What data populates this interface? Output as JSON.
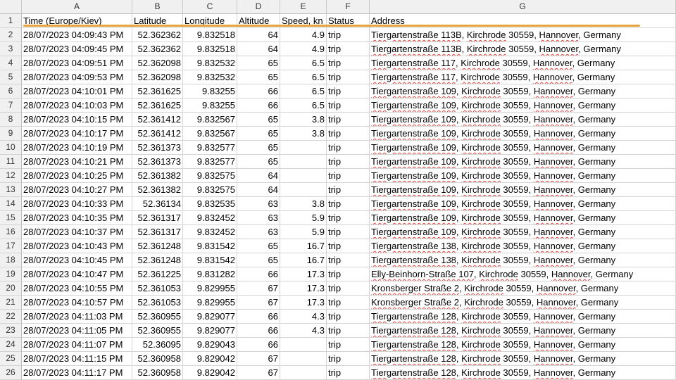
{
  "columns": [
    "A",
    "B",
    "C",
    "D",
    "E",
    "F",
    "G"
  ],
  "headers": [
    "Time (Europe/Kiev)",
    "Latitude",
    "Longitude",
    "Altitude",
    "Speed, kn",
    "Status",
    "Address"
  ],
  "accent_color": "#e8a33d",
  "rows": [
    {
      "n": "2",
      "time": "28/07/2023 04:09:43 PM",
      "lat": "52.362362",
      "lon": "9.832518",
      "alt": "64",
      "spd": "4.9",
      "status": "trip",
      "street": "Tiergartenstraße 113B",
      "district": "Kirchrode",
      "zip": "30559",
      "city": "Hannover",
      "country": "Germany"
    },
    {
      "n": "3",
      "time": "28/07/2023 04:09:45 PM",
      "lat": "52.362362",
      "lon": "9.832518",
      "alt": "64",
      "spd": "4.9",
      "status": "trip",
      "street": "Tiergartenstraße 113B",
      "district": "Kirchrode",
      "zip": "30559",
      "city": "Hannover",
      "country": "Germany"
    },
    {
      "n": "4",
      "time": "28/07/2023 04:09:51 PM",
      "lat": "52.362098",
      "lon": "9.832532",
      "alt": "65",
      "spd": "6.5",
      "status": "trip",
      "street": "Tiergartenstraße 117",
      "district": "Kirchrode",
      "zip": "30559",
      "city": "Hannover",
      "country": "Germany"
    },
    {
      "n": "5",
      "time": "28/07/2023 04:09:53 PM",
      "lat": "52.362098",
      "lon": "9.832532",
      "alt": "65",
      "spd": "6.5",
      "status": "trip",
      "street": "Tiergartenstraße 117",
      "district": "Kirchrode",
      "zip": "30559",
      "city": "Hannover",
      "country": "Germany"
    },
    {
      "n": "6",
      "time": "28/07/2023 04:10:01 PM",
      "lat": "52.361625",
      "lon": "9.83255",
      "alt": "66",
      "spd": "6.5",
      "status": "trip",
      "street": "Tiergartenstraße 109",
      "district": "Kirchrode",
      "zip": "30559",
      "city": "Hannover",
      "country": "Germany"
    },
    {
      "n": "7",
      "time": "28/07/2023 04:10:03 PM",
      "lat": "52.361625",
      "lon": "9.83255",
      "alt": "66",
      "spd": "6.5",
      "status": "trip",
      "street": "Tiergartenstraße 109",
      "district": "Kirchrode",
      "zip": "30559",
      "city": "Hannover",
      "country": "Germany"
    },
    {
      "n": "8",
      "time": "28/07/2023 04:10:15 PM",
      "lat": "52.361412",
      "lon": "9.832567",
      "alt": "65",
      "spd": "3.8",
      "status": "trip",
      "street": "Tiergartenstraße 109",
      "district": "Kirchrode",
      "zip": "30559",
      "city": "Hannover",
      "country": "Germany"
    },
    {
      "n": "9",
      "time": "28/07/2023 04:10:17 PM",
      "lat": "52.361412",
      "lon": "9.832567",
      "alt": "65",
      "spd": "3.8",
      "status": "trip",
      "street": "Tiergartenstraße 109",
      "district": "Kirchrode",
      "zip": "30559",
      "city": "Hannover",
      "country": "Germany"
    },
    {
      "n": "10",
      "time": "28/07/2023 04:10:19 PM",
      "lat": "52.361373",
      "lon": "9.832577",
      "alt": "65",
      "spd": "",
      "status": "trip",
      "street": "Tiergartenstraße 109",
      "district": "Kirchrode",
      "zip": "30559",
      "city": "Hannover",
      "country": "Germany"
    },
    {
      "n": "11",
      "time": "28/07/2023 04:10:21 PM",
      "lat": "52.361373",
      "lon": "9.832577",
      "alt": "65",
      "spd": "",
      "status": "trip",
      "street": "Tiergartenstraße 109",
      "district": "Kirchrode",
      "zip": "30559",
      "city": "Hannover",
      "country": "Germany"
    },
    {
      "n": "12",
      "time": "28/07/2023 04:10:25 PM",
      "lat": "52.361382",
      "lon": "9.832575",
      "alt": "64",
      "spd": "",
      "status": "trip",
      "street": "Tiergartenstraße 109",
      "district": "Kirchrode",
      "zip": "30559",
      "city": "Hannover",
      "country": "Germany"
    },
    {
      "n": "13",
      "time": "28/07/2023 04:10:27 PM",
      "lat": "52.361382",
      "lon": "9.832575",
      "alt": "64",
      "spd": "",
      "status": "trip",
      "street": "Tiergartenstraße 109",
      "district": "Kirchrode",
      "zip": "30559",
      "city": "Hannover",
      "country": "Germany"
    },
    {
      "n": "14",
      "time": "28/07/2023 04:10:33 PM",
      "lat": "52.36134",
      "lon": "9.832535",
      "alt": "63",
      "spd": "3.8",
      "status": "trip",
      "street": "Tiergartenstraße 109",
      "district": "Kirchrode",
      "zip": "30559",
      "city": "Hannover",
      "country": "Germany"
    },
    {
      "n": "15",
      "time": "28/07/2023 04:10:35 PM",
      "lat": "52.361317",
      "lon": "9.832452",
      "alt": "63",
      "spd": "5.9",
      "status": "trip",
      "street": "Tiergartenstraße 109",
      "district": "Kirchrode",
      "zip": "30559",
      "city": "Hannover",
      "country": "Germany"
    },
    {
      "n": "16",
      "time": "28/07/2023 04:10:37 PM",
      "lat": "52.361317",
      "lon": "9.832452",
      "alt": "63",
      "spd": "5.9",
      "status": "trip",
      "street": "Tiergartenstraße 109",
      "district": "Kirchrode",
      "zip": "30559",
      "city": "Hannover",
      "country": "Germany"
    },
    {
      "n": "17",
      "time": "28/07/2023 04:10:43 PM",
      "lat": "52.361248",
      "lon": "9.831542",
      "alt": "65",
      "spd": "16.7",
      "status": "trip",
      "street": "Tiergartenstraße 138",
      "district": "Kirchrode",
      "zip": "30559",
      "city": "Hannover",
      "country": "Germany"
    },
    {
      "n": "18",
      "time": "28/07/2023 04:10:45 PM",
      "lat": "52.361248",
      "lon": "9.831542",
      "alt": "65",
      "spd": "16.7",
      "status": "trip",
      "street": "Tiergartenstraße 138",
      "district": "Kirchrode",
      "zip": "30559",
      "city": "Hannover",
      "country": "Germany"
    },
    {
      "n": "19",
      "time": "28/07/2023 04:10:47 PM",
      "lat": "52.361225",
      "lon": "9.831282",
      "alt": "66",
      "spd": "17.3",
      "status": "trip",
      "street": "Elly-Beinhorn-Straße 107",
      "district": "Kirchrode",
      "zip": "30559",
      "city": "Hannover",
      "country": "Germany"
    },
    {
      "n": "20",
      "time": "28/07/2023 04:10:55 PM",
      "lat": "52.361053",
      "lon": "9.829955",
      "alt": "67",
      "spd": "17.3",
      "status": "trip",
      "street": "Kronsberger Straße 2",
      "district": "Kirchrode",
      "zip": "30559",
      "city": "Hannover",
      "country": "Germany"
    },
    {
      "n": "21",
      "time": "28/07/2023 04:10:57 PM",
      "lat": "52.361053",
      "lon": "9.829955",
      "alt": "67",
      "spd": "17.3",
      "status": "trip",
      "street": "Kronsberger Straße 2",
      "district": "Kirchrode",
      "zip": "30559",
      "city": "Hannover",
      "country": "Germany"
    },
    {
      "n": "22",
      "time": "28/07/2023 04:11:03 PM",
      "lat": "52.360955",
      "lon": "9.829077",
      "alt": "66",
      "spd": "4.3",
      "status": "trip",
      "street": "Tiergartenstraße 128",
      "district": "Kirchrode",
      "zip": "30559",
      "city": "Hannover",
      "country": "Germany"
    },
    {
      "n": "23",
      "time": "28/07/2023 04:11:05 PM",
      "lat": "52.360955",
      "lon": "9.829077",
      "alt": "66",
      "spd": "4.3",
      "status": "trip",
      "street": "Tiergartenstraße 128",
      "district": "Kirchrode",
      "zip": "30559",
      "city": "Hannover",
      "country": "Germany"
    },
    {
      "n": "24",
      "time": "28/07/2023 04:11:07 PM",
      "lat": "52.36095",
      "lon": "9.829043",
      "alt": "66",
      "spd": "",
      "status": "trip",
      "street": "Tiergartenstraße 128",
      "district": "Kirchrode",
      "zip": "30559",
      "city": "Hannover",
      "country": "Germany"
    },
    {
      "n": "25",
      "time": "28/07/2023 04:11:15 PM",
      "lat": "52.360958",
      "lon": "9.829042",
      "alt": "67",
      "spd": "",
      "status": "trip",
      "street": "Tiergartenstraße 128",
      "district": "Kirchrode",
      "zip": "30559",
      "city": "Hannover",
      "country": "Germany"
    },
    {
      "n": "26",
      "time": "28/07/2023 04:11:17 PM",
      "lat": "52.360958",
      "lon": "9.829042",
      "alt": "67",
      "spd": "",
      "status": "trip",
      "street": "Tiergartenstraße 128",
      "district": "Kirchrode",
      "zip": "30559",
      "city": "Hannover",
      "country": "Germany"
    }
  ]
}
